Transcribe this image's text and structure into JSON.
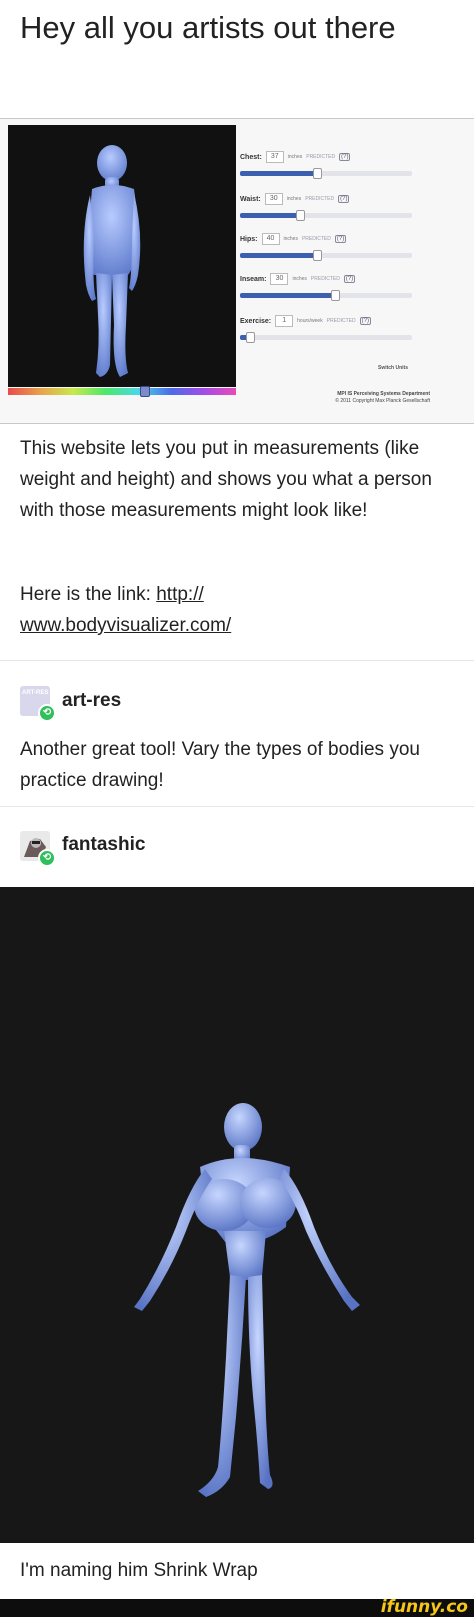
{
  "post": {
    "title": "Hey all you artists out there",
    "body_line1": "This website lets you put in measurements (like weight and height) and shows you what a person with those measurements might look like!",
    "link_prefix": "Here is the link: ",
    "link_text": "http://\nwww.bodyvisualizer.com/",
    "caption": "I'm naming him Shrink Wrap"
  },
  "screenshot": {
    "measurements": [
      {
        "label": "Chest:",
        "value": "37",
        "unit": "inches",
        "predicted": "PREDICTED",
        "help": "(?)",
        "level": 0.45
      },
      {
        "label": "Waist:",
        "value": "30",
        "unit": "inches",
        "predicted": "PREDICTED",
        "help": "(?)",
        "level": 0.35
      },
      {
        "label": "Hips:",
        "value": "40",
        "unit": "inches",
        "predicted": "PREDICTED",
        "help": "(?)",
        "level": 0.45
      },
      {
        "label": "Inseam:",
        "value": "30",
        "unit": "inches",
        "predicted": "PREDICTED",
        "help": "(?)",
        "level": 0.55
      },
      {
        "label": "Exercise:",
        "value": "1",
        "unit": "hours/week",
        "predicted": "PREDICTED",
        "help": "(?)",
        "level": 0.06
      }
    ],
    "switch_units": "Switch Units",
    "credit_dept": "MPI IS Perceiving Systems Department",
    "credit_copy": "© 2011 Copyright Max Planck Gesellschaft",
    "hue_level": 0.6
  },
  "comments": [
    {
      "username": "art-res",
      "avatar_text": "ART-RES",
      "text": "Another great tool! Vary the types of bodies you practice drawing!"
    },
    {
      "username": "fantashic",
      "text": ""
    }
  ],
  "footer": {
    "watermark": "ifunny.co"
  },
  "colors": {
    "figure": "#8ea8ea",
    "reblog": "#2fbf5b",
    "watermark": "#f5c518"
  }
}
